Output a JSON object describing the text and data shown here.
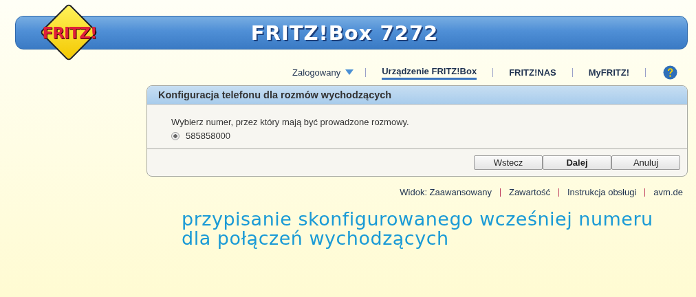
{
  "header": {
    "logo": "FRITZ!",
    "title": "FRITZ!Box 7272"
  },
  "nav": {
    "user_menu": "Zalogowany",
    "tabs": [
      {
        "label": "Urządzenie FRITZ!Box",
        "selected": true
      },
      {
        "label": "FRITZ!NAS",
        "selected": false
      },
      {
        "label": "MyFRITZ!",
        "selected": false
      }
    ]
  },
  "panel": {
    "title": "Konfiguracja telefonu dla rozmów wychodzących",
    "prompt": "Wybierz numer, przez który mają być prowadzone rozmowy.",
    "options": [
      {
        "label": "585858000",
        "selected": true
      }
    ],
    "buttons": [
      {
        "label": "Wstecz",
        "kind": "normal"
      },
      {
        "label": "Dalej",
        "kind": "default"
      },
      {
        "label": "Anuluj",
        "kind": "normal"
      }
    ]
  },
  "footer_links": [
    "Widok: Zaawansowany",
    "Zawartość",
    "Instrukcja obsługi",
    "avm.de"
  ],
  "caption": [
    "przypisanie skonfigurowanego wcześniej numeru",
    "dla połączeń wychodzących"
  ]
}
